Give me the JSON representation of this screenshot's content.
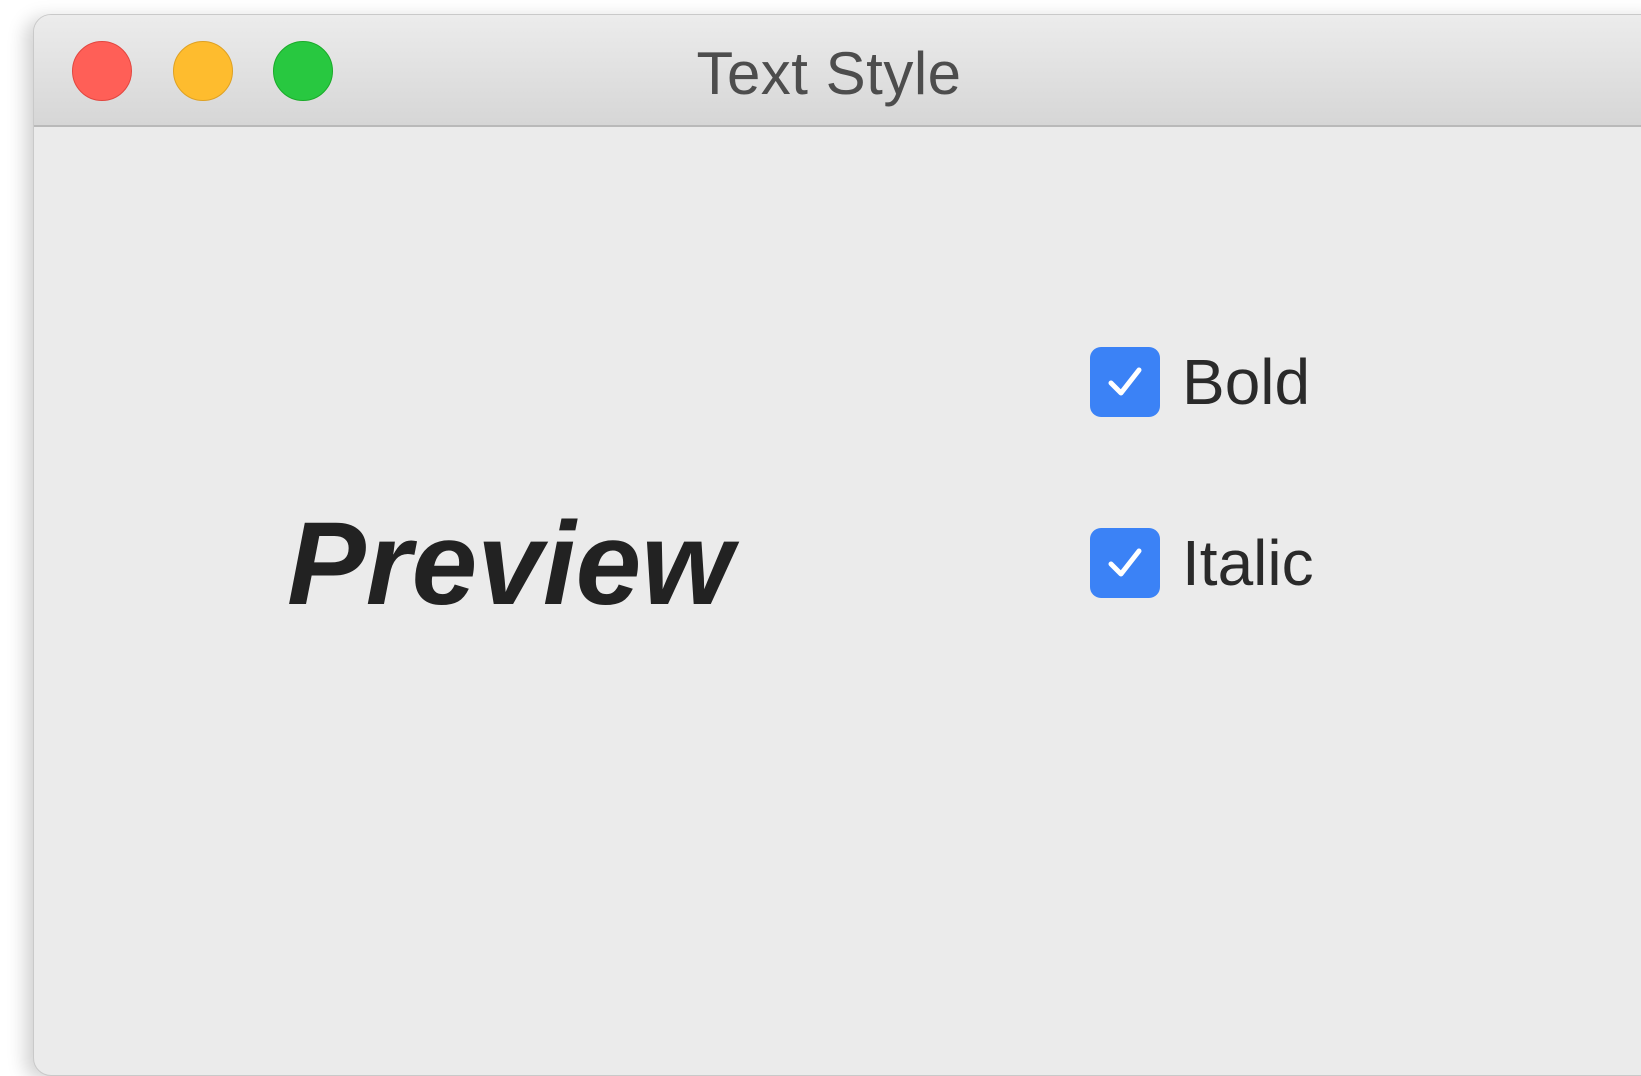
{
  "window": {
    "title": "Text Style"
  },
  "traffic_lights": {
    "close_color": "#ff5f57",
    "minimize_color": "#febc2e",
    "maximize_color": "#28c840"
  },
  "preview": {
    "text": "Preview",
    "bold": true,
    "italic": true
  },
  "options": [
    {
      "label": "Bold",
      "checked": true
    },
    {
      "label": "Italic",
      "checked": true
    }
  ],
  "colors": {
    "accent": "#3b82f6",
    "window_background": "#ebebeb"
  }
}
